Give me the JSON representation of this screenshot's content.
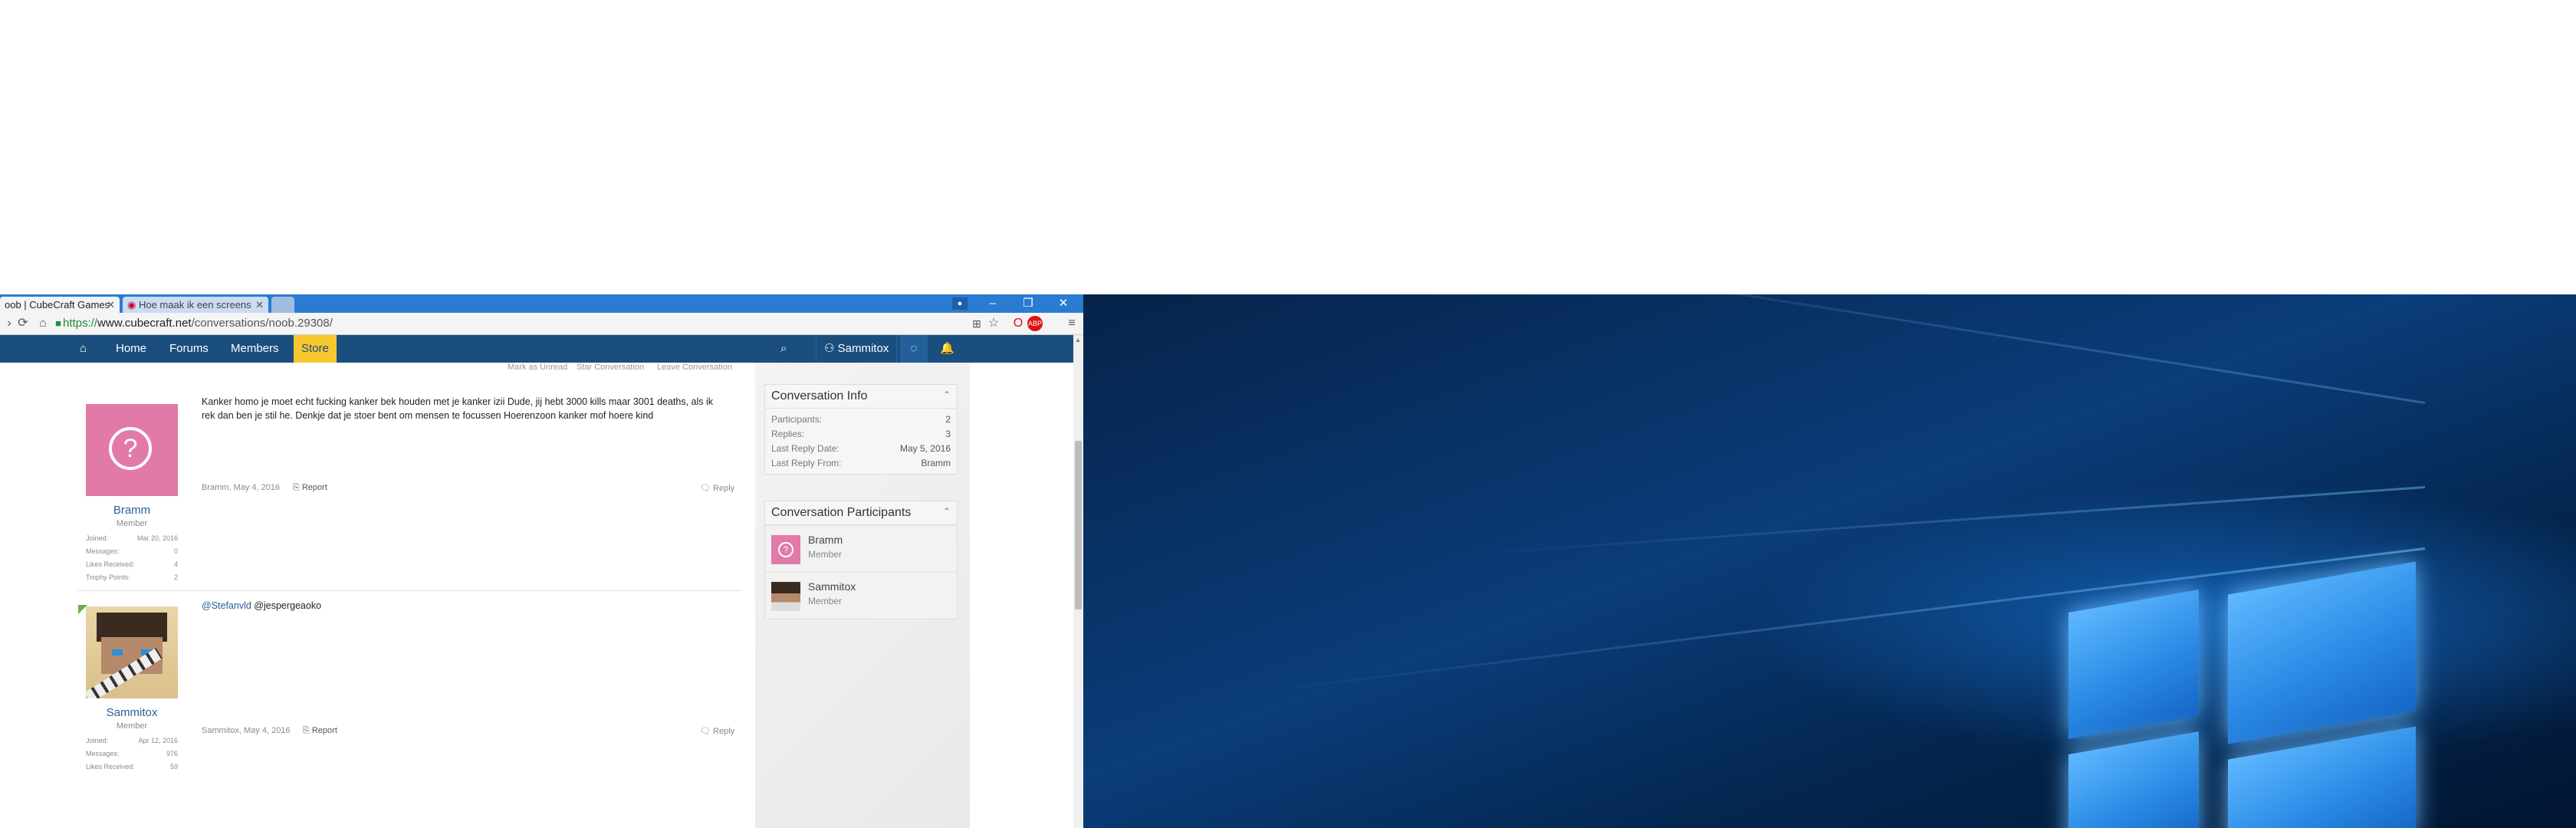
{
  "browser": {
    "tabs": [
      {
        "label": "oob | CubeCraft Games",
        "active": true
      },
      {
        "label": "Hoe maak ik een screens",
        "active": false
      }
    ],
    "url": {
      "scheme": "https://",
      "host": "www.cubecraft.net",
      "path": "/conversations/noob.29308/"
    },
    "window_controls": {
      "minimize": "–",
      "restore": "❐",
      "close": "✕"
    }
  },
  "nav": {
    "home": "Home",
    "forums": "Forums",
    "members": "Members",
    "store": "Store",
    "username": "Sammitox"
  },
  "conversation_actions": {
    "mark_unread": "Mark as Unread",
    "star": "Star Conversation",
    "leave": "Leave Conversation"
  },
  "posts": [
    {
      "author": "Bramm",
      "title": "Member",
      "text": "Kanker homo je moet echt fucking kanker bek houden met je kanker izii Dude, jij hebt 3000 kills maar 3001 deaths, als ik rek dan ben je stil he. Denkje dat je stoer bent om mensen te focussen Hoerenzoon kanker mof hoere kind",
      "meta": "Bramm, May 4, 2016",
      "report": "Report",
      "reply": "Reply",
      "stats": [
        {
          "label": "Joined:",
          "value": "Mar 20, 2016"
        },
        {
          "label": "Messages:",
          "value": "0"
        },
        {
          "label": "Likes Received:",
          "value": "4"
        },
        {
          "label": "Trophy Points:",
          "value": "2"
        }
      ]
    },
    {
      "author": "Sammitox",
      "title": "Member",
      "mention1": "@Stefanvld",
      "mention2": "@jespergeaoko",
      "meta": "Sammitox, May 4, 2016",
      "report": "Report",
      "reply": "Reply",
      "stats": [
        {
          "label": "Joined:",
          "value": "Apr 12, 2016"
        },
        {
          "label": "Messages:",
          "value": "976"
        },
        {
          "label": "Likes Received:",
          "value": "59"
        }
      ]
    }
  ],
  "conversation_info": {
    "heading": "Conversation Info",
    "rows": [
      {
        "label": "Participants:",
        "value": "2"
      },
      {
        "label": "Replies:",
        "value": "3"
      },
      {
        "label": "Last Reply Date:",
        "value": "May 5, 2016"
      },
      {
        "label": "Last Reply From:",
        "value": "Bramm"
      }
    ]
  },
  "participants": {
    "heading": "Conversation Participants",
    "items": [
      {
        "name": "Bramm",
        "title": "Member"
      },
      {
        "name": "Sammitox",
        "title": "Member"
      }
    ]
  },
  "colors": {
    "nav": "#1a4e7f",
    "store": "#f6c82e",
    "titlebar": "#2a7bd2",
    "avatar_pink": "#e27aa8"
  }
}
